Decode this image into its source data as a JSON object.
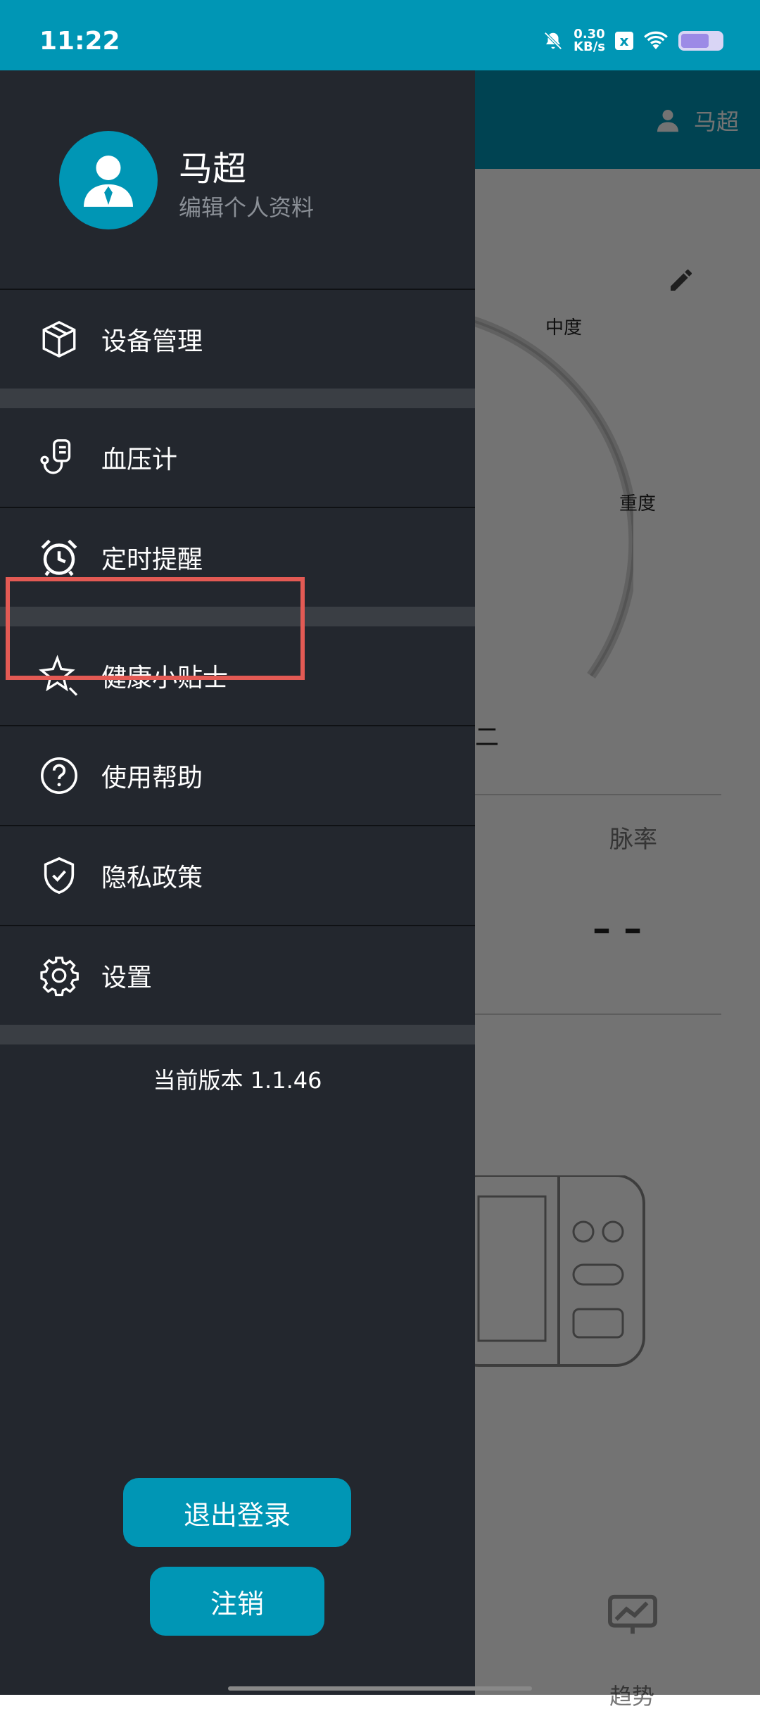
{
  "status_bar": {
    "time": "11:22",
    "net_speed_value": "0.30",
    "net_speed_unit": "KB/s",
    "x_badge": "x",
    "battery_level": 0.7
  },
  "background_app": {
    "header_user": "马超",
    "gauge_moderate": "中度",
    "gauge_severe": "重度",
    "partial_text": "二",
    "pulse_label": "脉率",
    "pulse_value": "– –",
    "tab_trend": "趋势"
  },
  "drawer": {
    "profile": {
      "name": "马超",
      "edit_label": "编辑个人资料"
    },
    "menu": [
      {
        "label": "设备管理"
      },
      {
        "label": "血压计"
      },
      {
        "label": "定时提醒"
      },
      {
        "label": "健康小贴士"
      },
      {
        "label": "使用帮助"
      },
      {
        "label": "隐私政策"
      },
      {
        "label": "设置"
      }
    ],
    "version": "当前版本 1.1.46",
    "logout_label": "退出登录",
    "deregister_label": "注销"
  },
  "colors": {
    "accent": "#0096b5",
    "drawer_bg": "#23272e",
    "highlight": "#e35a54"
  }
}
